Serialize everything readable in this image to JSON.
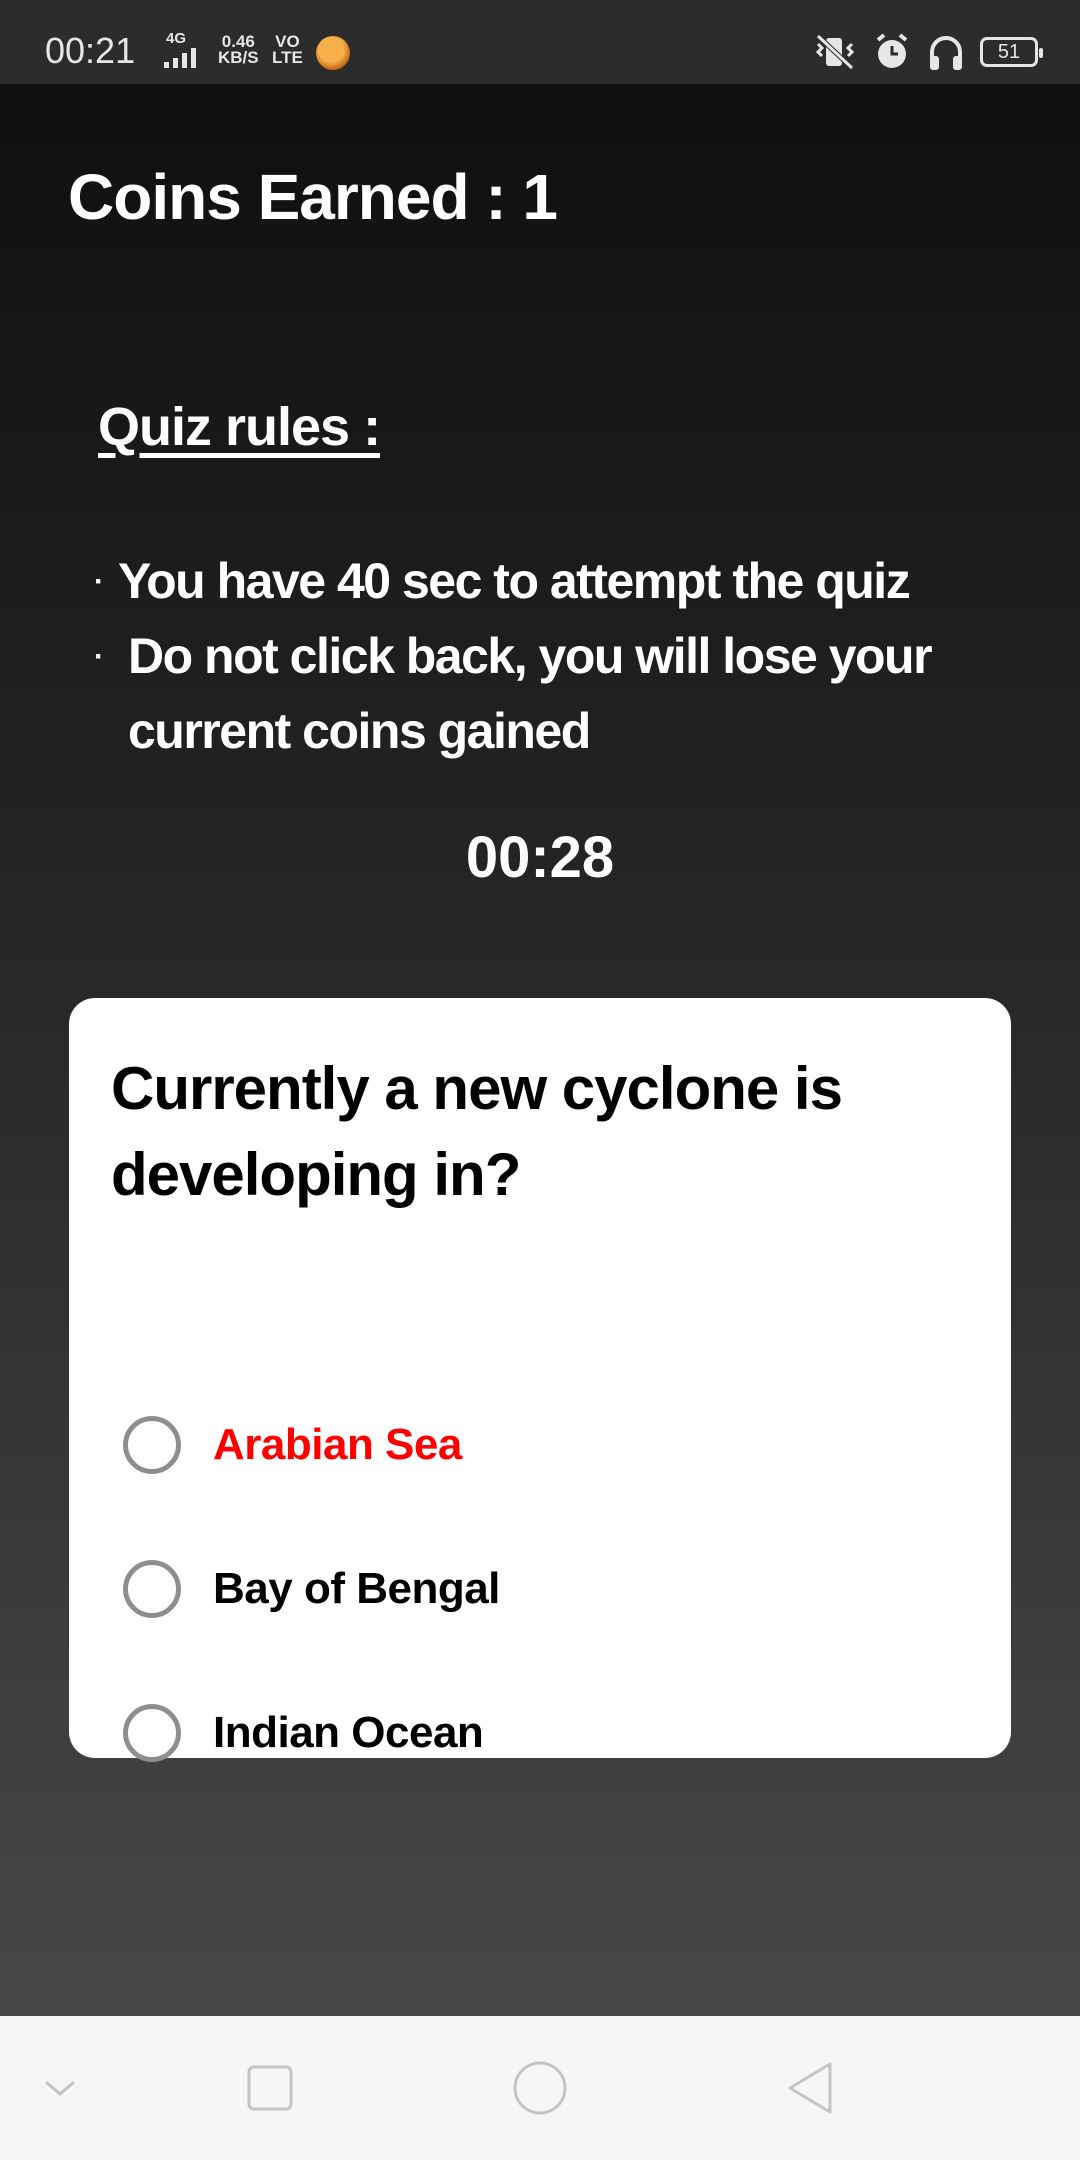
{
  "status_bar": {
    "time": "00:21",
    "network_tag": "4G",
    "speed_value": "0.46",
    "speed_unit": "KB/S",
    "volte_top": "VO",
    "volte_bottom": "LTE",
    "battery": "51"
  },
  "header": {
    "coins_text": "Coins Earned : 1"
  },
  "rules": {
    "title": "Quiz rules :",
    "bullet": "·",
    "items": [
      "You have 40 sec to attempt the quiz",
      "Do not click back, you will lose your current coins gained"
    ]
  },
  "timer": "00:28",
  "quiz": {
    "question": "Currently a new cyclone is developing in?",
    "options": [
      {
        "label": "Arabian Sea",
        "color": "#ff0000"
      },
      {
        "label": "Bay of Bengal",
        "color": "#000000"
      },
      {
        "label": "Indian Ocean",
        "color": "#000000"
      }
    ]
  },
  "nav_bar": {
    "icons": [
      "chevron-down-icon",
      "recents-square-icon",
      "home-circle-icon",
      "back-triangle-icon"
    ]
  }
}
